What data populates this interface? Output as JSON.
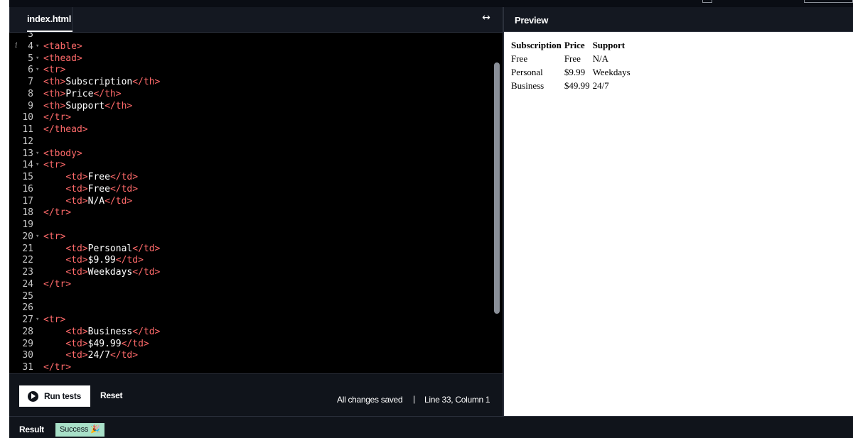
{
  "editor": {
    "tab_label": "index.html",
    "expand_icon": "↔",
    "lines": [
      {
        "n": "3",
        "fold": false,
        "info": false,
        "indent": "",
        "parts": []
      },
      {
        "n": "4",
        "fold": true,
        "info": true,
        "indent": "",
        "parts": [
          {
            "t": "tag",
            "v": "<table>"
          }
        ]
      },
      {
        "n": "5",
        "fold": true,
        "info": false,
        "indent": "",
        "parts": [
          {
            "t": "tag",
            "v": "<thead>"
          }
        ]
      },
      {
        "n": "6",
        "fold": true,
        "info": false,
        "indent": "",
        "parts": [
          {
            "t": "tag",
            "v": "<tr>"
          }
        ]
      },
      {
        "n": "7",
        "fold": false,
        "info": false,
        "indent": "",
        "parts": [
          {
            "t": "tag",
            "v": "<th>"
          },
          {
            "t": "txt",
            "v": "Subscription"
          },
          {
            "t": "tag",
            "v": "</th>"
          }
        ]
      },
      {
        "n": "8",
        "fold": false,
        "info": false,
        "indent": "",
        "parts": [
          {
            "t": "tag",
            "v": "<th>"
          },
          {
            "t": "txt",
            "v": "Price"
          },
          {
            "t": "tag",
            "v": "</th>"
          }
        ]
      },
      {
        "n": "9",
        "fold": false,
        "info": false,
        "indent": "",
        "parts": [
          {
            "t": "tag",
            "v": "<th>"
          },
          {
            "t": "txt",
            "v": "Support"
          },
          {
            "t": "tag",
            "v": "</th>"
          }
        ]
      },
      {
        "n": "10",
        "fold": false,
        "info": false,
        "indent": "",
        "parts": [
          {
            "t": "tag",
            "v": "</tr>"
          }
        ]
      },
      {
        "n": "11",
        "fold": false,
        "info": false,
        "indent": "",
        "parts": [
          {
            "t": "tag",
            "v": "</thead>"
          }
        ]
      },
      {
        "n": "12",
        "fold": false,
        "info": false,
        "indent": "",
        "parts": []
      },
      {
        "n": "13",
        "fold": true,
        "info": false,
        "indent": "",
        "parts": [
          {
            "t": "tag",
            "v": "<tbody>"
          }
        ]
      },
      {
        "n": "14",
        "fold": true,
        "info": false,
        "indent": "",
        "parts": [
          {
            "t": "tag",
            "v": "<tr>"
          }
        ]
      },
      {
        "n": "15",
        "fold": false,
        "info": false,
        "indent": "    ",
        "parts": [
          {
            "t": "tag",
            "v": "<td>"
          },
          {
            "t": "txt",
            "v": "Free"
          },
          {
            "t": "tag",
            "v": "</td>"
          }
        ]
      },
      {
        "n": "16",
        "fold": false,
        "info": false,
        "indent": "    ",
        "parts": [
          {
            "t": "tag",
            "v": "<td>"
          },
          {
            "t": "txt",
            "v": "Free"
          },
          {
            "t": "tag",
            "v": "</td>"
          }
        ]
      },
      {
        "n": "17",
        "fold": false,
        "info": false,
        "indent": "    ",
        "parts": [
          {
            "t": "tag",
            "v": "<td>"
          },
          {
            "t": "txt",
            "v": "N/A"
          },
          {
            "t": "tag",
            "v": "</td>"
          }
        ]
      },
      {
        "n": "18",
        "fold": false,
        "info": false,
        "indent": "",
        "parts": [
          {
            "t": "tag",
            "v": "</tr>"
          }
        ]
      },
      {
        "n": "19",
        "fold": false,
        "info": false,
        "indent": "",
        "parts": []
      },
      {
        "n": "20",
        "fold": true,
        "info": false,
        "indent": "",
        "parts": [
          {
            "t": "tag",
            "v": "<tr>"
          }
        ]
      },
      {
        "n": "21",
        "fold": false,
        "info": false,
        "indent": "    ",
        "parts": [
          {
            "t": "tag",
            "v": "<td>"
          },
          {
            "t": "txt",
            "v": "Personal"
          },
          {
            "t": "tag",
            "v": "</td>"
          }
        ]
      },
      {
        "n": "22",
        "fold": false,
        "info": false,
        "indent": "    ",
        "parts": [
          {
            "t": "tag",
            "v": "<td>"
          },
          {
            "t": "txt",
            "v": "$9.99"
          },
          {
            "t": "tag",
            "v": "</td>"
          }
        ]
      },
      {
        "n": "23",
        "fold": false,
        "info": false,
        "indent": "    ",
        "parts": [
          {
            "t": "tag",
            "v": "<td>"
          },
          {
            "t": "txt",
            "v": "Weekdays"
          },
          {
            "t": "tag",
            "v": "</td>"
          }
        ]
      },
      {
        "n": "24",
        "fold": false,
        "info": false,
        "indent": "",
        "parts": [
          {
            "t": "tag",
            "v": "</tr>"
          }
        ]
      },
      {
        "n": "25",
        "fold": false,
        "info": false,
        "indent": "",
        "parts": []
      },
      {
        "n": "26",
        "fold": false,
        "info": false,
        "indent": "",
        "parts": []
      },
      {
        "n": "27",
        "fold": true,
        "info": false,
        "indent": "",
        "parts": [
          {
            "t": "tag",
            "v": "<tr>"
          }
        ]
      },
      {
        "n": "28",
        "fold": false,
        "info": false,
        "indent": "    ",
        "parts": [
          {
            "t": "tag",
            "v": "<td>"
          },
          {
            "t": "txt",
            "v": "Business"
          },
          {
            "t": "tag",
            "v": "</td>"
          }
        ]
      },
      {
        "n": "29",
        "fold": false,
        "info": false,
        "indent": "    ",
        "parts": [
          {
            "t": "tag",
            "v": "<td>"
          },
          {
            "t": "txt",
            "v": "$49.99"
          },
          {
            "t": "tag",
            "v": "</td>"
          }
        ]
      },
      {
        "n": "30",
        "fold": false,
        "info": false,
        "indent": "    ",
        "parts": [
          {
            "t": "tag",
            "v": "<td>"
          },
          {
            "t": "txt",
            "v": "24/7"
          },
          {
            "t": "tag",
            "v": "</td>"
          }
        ]
      },
      {
        "n": "31",
        "fold": false,
        "info": false,
        "indent": "",
        "parts": [
          {
            "t": "tag",
            "v": "</tr>"
          }
        ]
      }
    ]
  },
  "footer": {
    "run_tests_label": "Run tests",
    "reset_label": "Reset",
    "save_status": "All changes saved",
    "separator": "|",
    "cursor_position": "Line 33, Column 1"
  },
  "preview": {
    "title": "Preview",
    "table": {
      "headers": [
        "Subscription",
        "Price",
        "Support"
      ],
      "rows": [
        [
          "Free",
          "Free",
          "N/A"
        ],
        [
          "Personal",
          "$9.99",
          "Weekdays"
        ],
        [
          "Business",
          "$49.99",
          "24/7"
        ]
      ]
    }
  },
  "result": {
    "label": "Result",
    "badge": "Success 🎉"
  },
  "colors": {
    "tag": "#ff6a6a",
    "text": "#ffffff",
    "success_bg": "#a8e0c8",
    "chrome_bg": "#141821"
  }
}
